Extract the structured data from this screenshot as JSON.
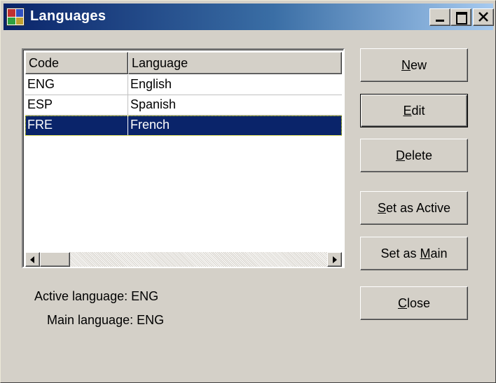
{
  "window": {
    "title": "Languages",
    "icon": "languages-app-icon"
  },
  "titlebar_buttons": {
    "minimize": "minimize-icon",
    "maximize": "maximize-icon",
    "close": "close-icon"
  },
  "list": {
    "columns": [
      "Code",
      "Language"
    ],
    "rows": [
      {
        "code": "ENG",
        "language": "English",
        "selected": false
      },
      {
        "code": "ESP",
        "language": "Spanish",
        "selected": false
      },
      {
        "code": "FRE",
        "language": "French",
        "selected": true
      }
    ]
  },
  "buttons": {
    "new": {
      "pre": "",
      "accel": "N",
      "post": "ew"
    },
    "edit": {
      "pre": "",
      "accel": "E",
      "post": "dit"
    },
    "delete": {
      "pre": "",
      "accel": "D",
      "post": "elete"
    },
    "set_active": {
      "pre": "",
      "accel": "S",
      "post": "et as Active"
    },
    "set_main": {
      "pre": "Set as ",
      "accel": "M",
      "post": "ain"
    },
    "close": {
      "pre": "",
      "accel": "C",
      "post": "lose"
    }
  },
  "status": {
    "active_language": "Active language: ENG",
    "main_language": "Main language: ENG"
  },
  "colors": {
    "face": "#d4d0c8",
    "titlebar_start": "#0a246a",
    "titlebar_end": "#a6caf0",
    "selection": "#0a246a"
  }
}
